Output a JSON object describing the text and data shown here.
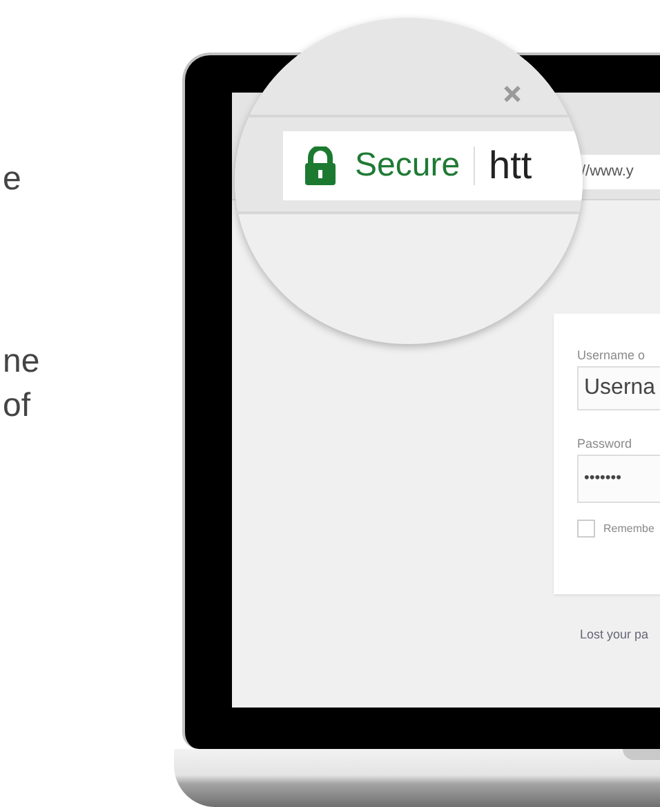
{
  "page_text": [
    [
      "e"
    ],
    [
      "ne",
      "of"
    ]
  ],
  "magnifier": {
    "secure_label": "Secure",
    "url_start": "htt"
  },
  "browser": {
    "address": "//www.y"
  },
  "login": {
    "username_label": "Username o",
    "username_value": "Userna",
    "password_label": "Password",
    "password_value": "•••••••",
    "remember": {
      "label": "Remembe",
      "checked": false
    },
    "lost_password_link": "Lost your pa"
  }
}
